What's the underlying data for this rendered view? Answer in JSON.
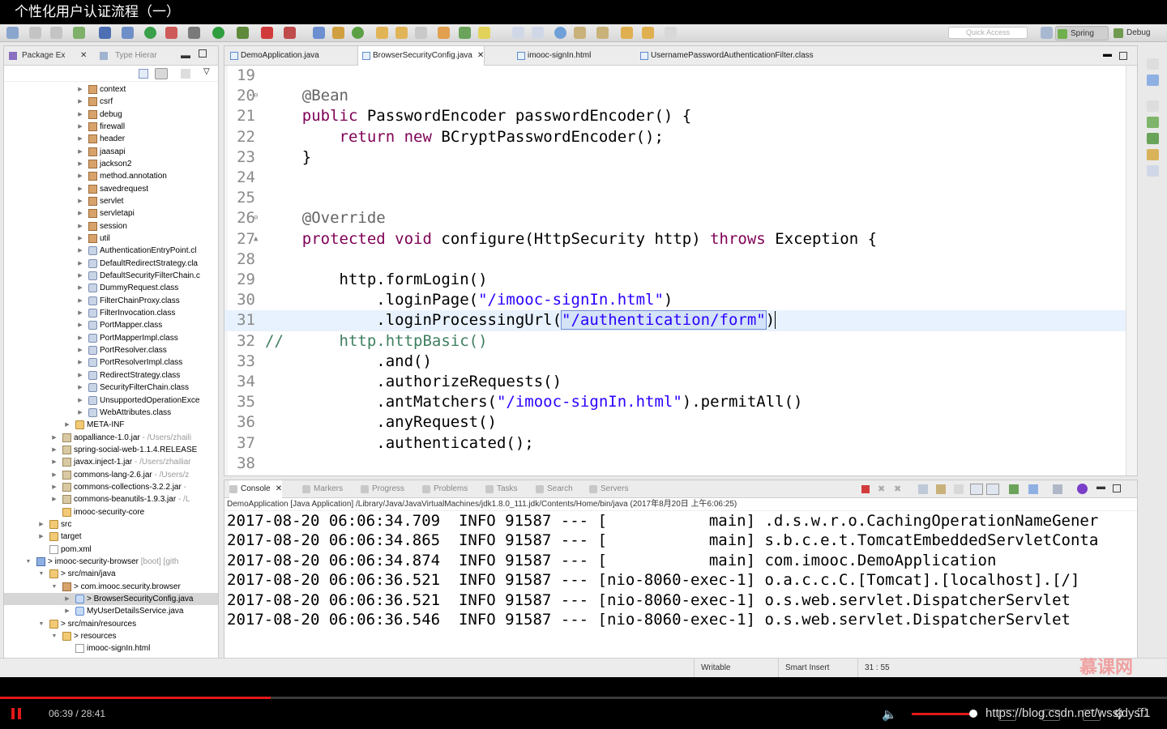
{
  "video": {
    "title": "个性化用户认证流程（一）",
    "time": "06:39 / 28:41",
    "progress": 0.2319,
    "volume": 0.95,
    "url": "https://blog.csdn.net/wssjdysf1"
  },
  "toolbar": {
    "quick_access_placeholder": "Quick Access",
    "spring_label": "Spring",
    "debug_label": "Debug"
  },
  "package_explorer": {
    "tab_label": "Package Ex",
    "type_hierarchy_label": "Type Hierar",
    "items": [
      {
        "indent": 5,
        "arrow": "▶",
        "icon": "package",
        "label": "context"
      },
      {
        "indent": 5,
        "arrow": "▶",
        "icon": "package",
        "label": "csrf"
      },
      {
        "indent": 5,
        "arrow": "▶",
        "icon": "package",
        "label": "debug"
      },
      {
        "indent": 5,
        "arrow": "▶",
        "icon": "package",
        "label": "firewall"
      },
      {
        "indent": 5,
        "arrow": "▶",
        "icon": "package",
        "label": "header"
      },
      {
        "indent": 5,
        "arrow": "▶",
        "icon": "package",
        "label": "jaasapi"
      },
      {
        "indent": 5,
        "arrow": "▶",
        "icon": "package",
        "label": "jackson2"
      },
      {
        "indent": 5,
        "arrow": "▶",
        "icon": "package",
        "label": "method.annotation"
      },
      {
        "indent": 5,
        "arrow": "▶",
        "icon": "package",
        "label": "savedrequest"
      },
      {
        "indent": 5,
        "arrow": "▶",
        "icon": "package",
        "label": "servlet"
      },
      {
        "indent": 5,
        "arrow": "▶",
        "icon": "package",
        "label": "servletapi"
      },
      {
        "indent": 5,
        "arrow": "▶",
        "icon": "package",
        "label": "session"
      },
      {
        "indent": 5,
        "arrow": "▶",
        "icon": "package",
        "label": "util"
      },
      {
        "indent": 5,
        "arrow": "▶",
        "icon": "class",
        "label": "AuthenticationEntryPoint.cl"
      },
      {
        "indent": 5,
        "arrow": "▶",
        "icon": "class",
        "label": "DefaultRedirectStrategy.cla"
      },
      {
        "indent": 5,
        "arrow": "▶",
        "icon": "class",
        "label": "DefaultSecurityFilterChain.c"
      },
      {
        "indent": 5,
        "arrow": "▶",
        "icon": "class",
        "label": "DummyRequest.class"
      },
      {
        "indent": 5,
        "arrow": "▶",
        "icon": "class",
        "label": "FilterChainProxy.class"
      },
      {
        "indent": 5,
        "arrow": "▶",
        "icon": "class",
        "label": "FilterInvocation.class"
      },
      {
        "indent": 5,
        "arrow": "▶",
        "icon": "class",
        "label": "PortMapper.class"
      },
      {
        "indent": 5,
        "arrow": "▶",
        "icon": "class",
        "label": "PortMapperImpl.class"
      },
      {
        "indent": 5,
        "arrow": "▶",
        "icon": "class",
        "label": "PortResolver.class"
      },
      {
        "indent": 5,
        "arrow": "▶",
        "icon": "class",
        "label": "PortResolverImpl.class"
      },
      {
        "indent": 5,
        "arrow": "▶",
        "icon": "class",
        "label": "RedirectStrategy.class"
      },
      {
        "indent": 5,
        "arrow": "▶",
        "icon": "class",
        "label": "SecurityFilterChain.class"
      },
      {
        "indent": 5,
        "arrow": "▶",
        "icon": "class",
        "label": "UnsupportedOperationExce"
      },
      {
        "indent": 5,
        "arrow": "▶",
        "icon": "class",
        "label": "WebAttributes.class"
      },
      {
        "indent": 4,
        "arrow": "▶",
        "icon": "folder",
        "label": "META-INF"
      },
      {
        "indent": 3,
        "arrow": "▶",
        "icon": "jar",
        "label": "aopalliance-1.0.jar",
        "dim": " - /Users/zhaili"
      },
      {
        "indent": 3,
        "arrow": "▶",
        "icon": "jar",
        "label": "spring-social-web-1.1.4.RELEASE"
      },
      {
        "indent": 3,
        "arrow": "▶",
        "icon": "jar",
        "label": "javax.inject-1.jar",
        "dim": " - /Users/zhailiar"
      },
      {
        "indent": 3,
        "arrow": "▶",
        "icon": "jar",
        "label": "commons-lang-2.6.jar",
        "dim": " - /Users/z"
      },
      {
        "indent": 3,
        "arrow": "▶",
        "icon": "jar",
        "label": "commons-collections-3.2.2.jar",
        "dim": " -"
      },
      {
        "indent": 3,
        "arrow": "▶",
        "icon": "jar",
        "label": "commons-beanutils-1.9.3.jar",
        "dim": " - /L"
      },
      {
        "indent": 3,
        "arrow": "",
        "icon": "folder",
        "label": "imooc-security-core"
      },
      {
        "indent": 2,
        "arrow": "▶",
        "icon": "folder",
        "label": "src"
      },
      {
        "indent": 2,
        "arrow": "▶",
        "icon": "folder",
        "label": "target"
      },
      {
        "indent": 2,
        "arrow": "",
        "icon": "file",
        "label": "pom.xml"
      },
      {
        "indent": 1,
        "arrow": "▼",
        "icon": "project",
        "label": "> imooc-security-browser",
        "dim": " [boot] [gith"
      },
      {
        "indent": 2,
        "arrow": "▼",
        "icon": "folder",
        "label": "> src/main/java"
      },
      {
        "indent": 3,
        "arrow": "▼",
        "icon": "package",
        "label": "> com.imooc.security.browser"
      },
      {
        "indent": 4,
        "arrow": "▶",
        "icon": "java",
        "label": "> BrowserSecurityConfig.java",
        "selected": true
      },
      {
        "indent": 4,
        "arrow": "▶",
        "icon": "java",
        "label": "MyUserDetailsService.java"
      },
      {
        "indent": 2,
        "arrow": "▼",
        "icon": "folder",
        "label": "> src/main/resources"
      },
      {
        "indent": 3,
        "arrow": "▼",
        "icon": "folder",
        "label": "> resources"
      },
      {
        "indent": 4,
        "arrow": "",
        "icon": "file",
        "label": "imooc-signIn.html"
      }
    ]
  },
  "editor": {
    "tabs": [
      {
        "label": "DemoApplication.java",
        "active": false
      },
      {
        "label": "BrowserSecurityConfig.java",
        "active": true,
        "close": "✕"
      },
      {
        "label": "imooc-signIn.html",
        "active": false
      },
      {
        "label": "UsernamePasswordAuthenticationFilter.class",
        "active": false
      }
    ],
    "lines": [
      {
        "n": "19",
        "tokens": []
      },
      {
        "n": "20",
        "marker": "⊖",
        "tokens": [
          {
            "t": "    "
          },
          {
            "t": "@Bean",
            "c": "ann"
          }
        ]
      },
      {
        "n": "21",
        "tokens": [
          {
            "t": "    "
          },
          {
            "t": "public",
            "c": "kw"
          },
          {
            "t": " PasswordEncoder passwordEncoder() {"
          }
        ]
      },
      {
        "n": "22",
        "tokens": [
          {
            "t": "        "
          },
          {
            "t": "return",
            "c": "kw"
          },
          {
            "t": " "
          },
          {
            "t": "new",
            "c": "kw"
          },
          {
            "t": " BCryptPasswordEncoder();"
          }
        ]
      },
      {
        "n": "23",
        "tokens": [
          {
            "t": "    }"
          }
        ]
      },
      {
        "n": "24",
        "tokens": []
      },
      {
        "n": "25",
        "tokens": []
      },
      {
        "n": "26",
        "marker": "⊖",
        "tokens": [
          {
            "t": "    "
          },
          {
            "t": "@Override",
            "c": "ann"
          }
        ]
      },
      {
        "n": "27",
        "marker": "▲",
        "tokens": [
          {
            "t": "    "
          },
          {
            "t": "protected",
            "c": "kw"
          },
          {
            "t": " "
          },
          {
            "t": "void",
            "c": "kw"
          },
          {
            "t": " configure(HttpSecurity http) "
          },
          {
            "t": "throws",
            "c": "kw"
          },
          {
            "t": " Exception {"
          }
        ]
      },
      {
        "n": "28",
        "tokens": []
      },
      {
        "n": "29",
        "tokens": [
          {
            "t": "        http.formLogin()"
          }
        ]
      },
      {
        "n": "30",
        "tokens": [
          {
            "t": "            .loginPage("
          },
          {
            "t": "\"/imooc-signIn.html\"",
            "c": "str"
          },
          {
            "t": ")"
          }
        ]
      },
      {
        "n": "31",
        "current": true,
        "tokens": [
          {
            "t": "            .loginProcessingUrl("
          },
          {
            "t": "\"/authentication/form\"",
            "c": "str sel"
          },
          {
            "t": ")"
          }
        ]
      },
      {
        "n": "32",
        "tokens": [
          {
            "t": "//",
            "c": "cmt"
          },
          {
            "t": "      http.httpBasic()",
            "c": "cmt"
          }
        ]
      },
      {
        "n": "33",
        "tokens": [
          {
            "t": "            .and()"
          }
        ]
      },
      {
        "n": "34",
        "tokens": [
          {
            "t": "            .authorizeRequests()"
          }
        ]
      },
      {
        "n": "35",
        "tokens": [
          {
            "t": "            .antMatchers("
          },
          {
            "t": "\"/imooc-signIn.html\"",
            "c": "str"
          },
          {
            "t": ").permitAll()"
          }
        ]
      },
      {
        "n": "36",
        "tokens": [
          {
            "t": "            .anyRequest()"
          }
        ]
      },
      {
        "n": "37",
        "tokens": [
          {
            "t": "            .authenticated();"
          }
        ]
      },
      {
        "n": "38",
        "tokens": []
      }
    ]
  },
  "console": {
    "tabs": [
      {
        "label": "Console",
        "active": true,
        "close": "✕"
      },
      {
        "label": "Markers"
      },
      {
        "label": "Progress"
      },
      {
        "label": "Problems"
      },
      {
        "label": "Tasks"
      },
      {
        "label": "Search"
      },
      {
        "label": "Servers"
      }
    ],
    "description": "DemoApplication [Java Application] /Library/Java/JavaVirtualMachines/jdk1.8.0_111.jdk/Contents/Home/bin/java (2017年8月20日 上午6:06:25)",
    "lines": [
      "2017-08-20 06:06:34.709  INFO 91587 --- [           main] .d.s.w.r.o.CachingOperationNameGener",
      "2017-08-20 06:06:34.865  INFO 91587 --- [           main] s.b.c.e.t.TomcatEmbeddedServletConta",
      "2017-08-20 06:06:34.874  INFO 91587 --- [           main] com.imooc.DemoApplication",
      "2017-08-20 06:06:36.521  INFO 91587 --- [nio-8060-exec-1] o.a.c.c.C.[Tomcat].[localhost].[/]",
      "2017-08-20 06:06:36.521  INFO 91587 --- [nio-8060-exec-1] o.s.web.servlet.DispatcherServlet",
      "2017-08-20 06:06:36.546  INFO 91587 --- [nio-8060-exec-1] o.s.web.servlet.DispatcherServlet"
    ]
  },
  "status": {
    "writable": "Writable",
    "insert_mode": "Smart Insert",
    "position": "31 : 55"
  },
  "watermark": "慕课网",
  "colors": {
    "keyword": "#7f0055",
    "string": "#2a00ff",
    "annotation": "#646464",
    "comment": "#3f7f5f",
    "accent": "#e0191b"
  }
}
